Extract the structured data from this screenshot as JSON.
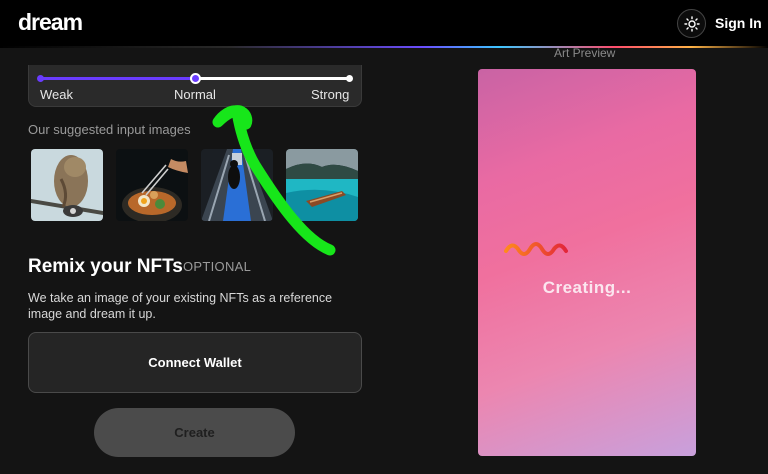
{
  "header": {
    "logo": "dream",
    "theme_icon": "sun-icon",
    "signin_label": "Sign In"
  },
  "style_slider": {
    "labels": [
      "Weak",
      "Normal",
      "Strong"
    ],
    "selected": "Normal",
    "value_fraction": 0.5
  },
  "suggested": {
    "title": "Our suggested input images",
    "images": [
      {
        "name": "owl-photo"
      },
      {
        "name": "food-bowl-photo"
      },
      {
        "name": "escalator-photo"
      },
      {
        "name": "boat-lake-photo"
      }
    ]
  },
  "remix": {
    "title": "Remix your NFTs",
    "optional": "OPTIONAL",
    "description": "We take an image of your existing NFTs as a reference image and dream it up.",
    "connect_label": "Connect Wallet"
  },
  "create_label": "Create",
  "preview": {
    "label": "Art Preview",
    "status": "Creating..."
  },
  "colors": {
    "accent": "#6a3cff",
    "scribble": "#17e61a",
    "preview_gradient_top": "#c963a4",
    "preview_gradient_bottom": "#c8a0dc"
  }
}
